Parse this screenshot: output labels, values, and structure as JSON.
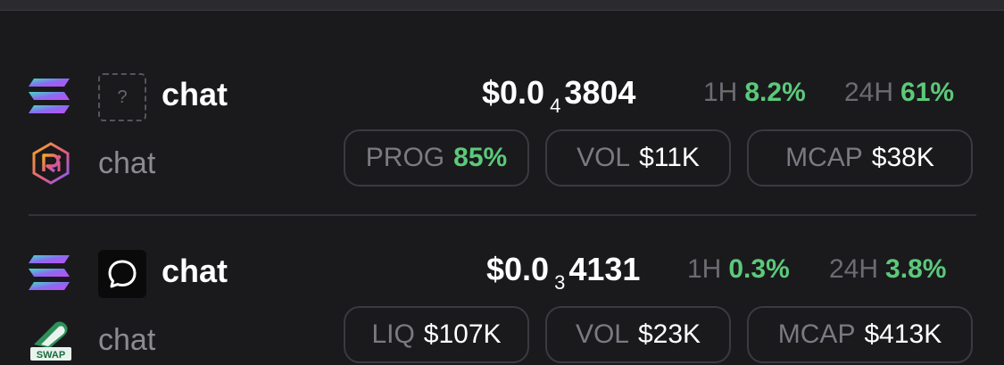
{
  "colors": {
    "background": "#1a1a1d",
    "positive": "#5cc97a",
    "muted": "#8b8b91",
    "pill_border": "#3a3a40"
  },
  "tokens": [
    {
      "chain_icon": "solana-icon",
      "thumb_icon": "question-mark-placeholder",
      "thumb_text": "?",
      "platform_icon": "raydium-icon",
      "name": "chat",
      "subname": "chat",
      "price_prefix": "$0.0",
      "price_zeros": "4",
      "price_digits": "3804",
      "h1_label": "1H",
      "h1_value": "8.2%",
      "h24_label": "24H",
      "h24_value": "61%",
      "stats": [
        {
          "label": "PROG",
          "value": "85%"
        },
        {
          "label": "VOL",
          "value": "$11K"
        },
        {
          "label": "MCAP",
          "value": "$38K"
        }
      ]
    },
    {
      "chain_icon": "solana-icon",
      "thumb_icon": "chat-bubble-icon",
      "platform_icon": "swap-icon",
      "platform_text": "SWAP",
      "name": "chat",
      "subname": "chat",
      "price_prefix": "$0.0",
      "price_zeros": "3",
      "price_digits": "4131",
      "h1_label": "1H",
      "h1_value": "0.3%",
      "h24_label": "24H",
      "h24_value": "3.8%",
      "stats": [
        {
          "label": "LIQ",
          "value": "$107K"
        },
        {
          "label": "VOL",
          "value": "$23K"
        },
        {
          "label": "MCAP",
          "value": "$413K"
        }
      ]
    }
  ]
}
